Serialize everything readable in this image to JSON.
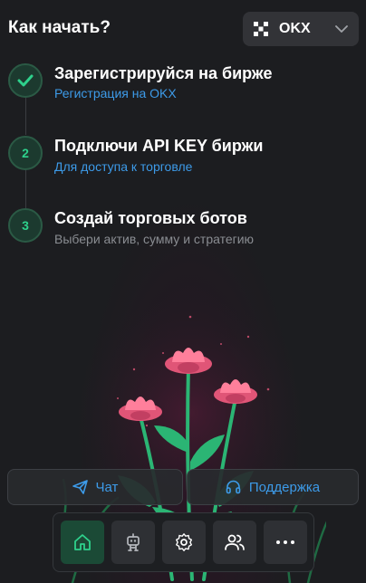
{
  "header": {
    "title": "Как начать?",
    "exchange": {
      "selected": "OKX",
      "icon": "okx-logo-icon"
    }
  },
  "steps": [
    {
      "marker": "check-icon",
      "title": "Зарегистрируйся на бирже",
      "subtitle": "Регистрация на OKX",
      "subtitle_is_link": true
    },
    {
      "marker": "2",
      "title": "Подключи API KEY биржи",
      "subtitle": "Для доступа к торговле",
      "subtitle_is_link": true
    },
    {
      "marker": "3",
      "title": "Создай торговых ботов",
      "subtitle": "Выбери актив, сумму и стратегию",
      "subtitle_is_link": false
    }
  ],
  "actions": {
    "chat": {
      "label": "Чат",
      "icon": "send-icon"
    },
    "support": {
      "label": "Поддержка",
      "icon": "headset-icon"
    }
  },
  "nav": [
    {
      "name": "home",
      "icon": "home-icon",
      "active": true
    },
    {
      "name": "bots",
      "icon": "robot-icon",
      "active": false
    },
    {
      "name": "settings",
      "icon": "gear-icon",
      "active": false
    },
    {
      "name": "users",
      "icon": "users-icon",
      "active": false
    },
    {
      "name": "more",
      "icon": "more-icon",
      "active": false
    }
  ],
  "colors": {
    "background": "#1c1d20",
    "accent_green": "#2ed18c",
    "link_blue": "#3d9be9",
    "muted": "#8a8d92",
    "flower_pink": "#e05577"
  }
}
